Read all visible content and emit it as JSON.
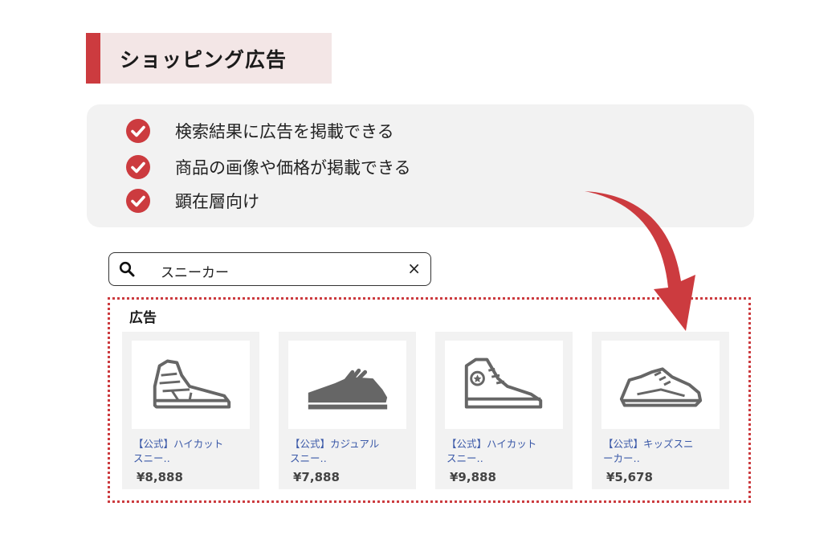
{
  "title": "ショッピング広告",
  "features": [
    {
      "text": "検索結果に広告を掲載できる",
      "icon": "check-circle-icon"
    },
    {
      "text": "商品の画像や価格が掲載できる",
      "icon": "check-circle-icon"
    },
    {
      "text": "顕在層向け",
      "icon": "check-circle-icon"
    }
  ],
  "search": {
    "query": "スニーカー",
    "search_icon": "search-icon",
    "clear_label": "×"
  },
  "ads": {
    "label": "広告",
    "products": [
      {
        "name_line1": "【公式】ハイカット",
        "name_line2": "スニー‥",
        "price": "¥8,888",
        "icon": "high-top-sneaker-icon"
      },
      {
        "name_line1": "【公式】カジュアル",
        "name_line2": "スニー‥",
        "price": "¥7,888",
        "icon": "casual-shoe-icon"
      },
      {
        "name_line1": "【公式】ハイカット",
        "name_line2": "スニー‥",
        "price": "¥9,888",
        "icon": "canvas-sneaker-icon"
      },
      {
        "name_line1": "【公式】キッズスニ",
        "name_line2": "ーカー‥",
        "price": "¥5,678",
        "icon": "running-shoe-icon"
      }
    ]
  },
  "colors": {
    "accent": "#cc3b3f",
    "title_bg": "#f3e6e6",
    "panel_bg": "#f2f2f2",
    "link": "#3b59a8"
  }
}
